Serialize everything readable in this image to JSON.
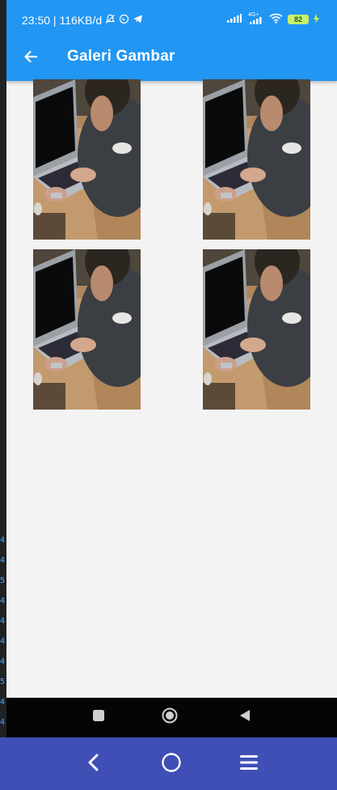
{
  "status_bar": {
    "time_text": "23:50 | 116KB/d",
    "network_label": "4G+",
    "battery_level": "82"
  },
  "app_bar": {
    "title": "Galeri Gambar"
  },
  "gallery": {
    "images": [
      {
        "subject": "person typing on laptop at wooden table"
      },
      {
        "subject": "person typing on laptop at wooden table"
      },
      {
        "subject": "person typing on laptop at wooden table"
      },
      {
        "subject": "person typing on laptop at wooden table"
      }
    ]
  },
  "left_strip_marks": [
    "4",
    "4",
    "5",
    "4",
    "4",
    "4",
    "4",
    "5",
    "4",
    "4",
    "5"
  ],
  "icons": {
    "back": "arrow-left-icon",
    "recents": "square-icon",
    "home": "circle-icon",
    "back_nav": "triangle-icon",
    "menu": "hamburger-icon"
  },
  "colors": {
    "app_bar": "#2196f3",
    "background": "#f3f3f3",
    "host_bar": "#3f4fb5",
    "nav_bar": "#050505"
  }
}
